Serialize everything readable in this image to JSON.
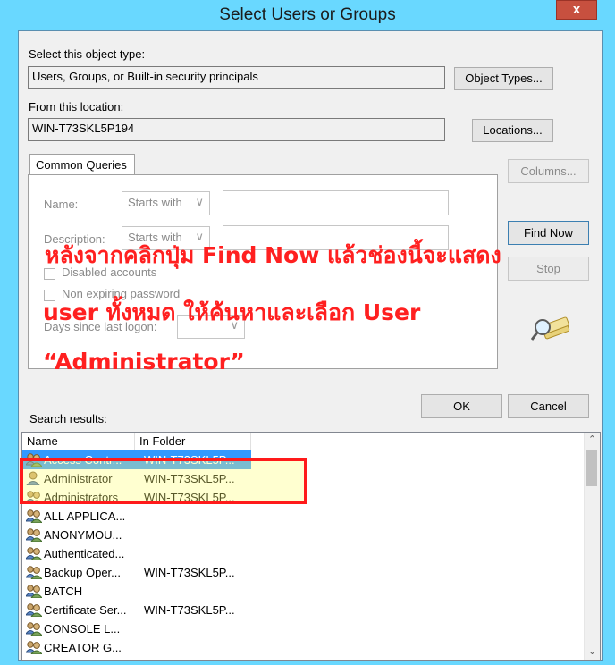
{
  "window": {
    "title": "Select Users or Groups",
    "close_glyph": "x"
  },
  "object_type": {
    "label": "Select this object type:",
    "value": "Users, Groups, or Built-in security principals",
    "button": "Object Types..."
  },
  "location": {
    "label": "From this location:",
    "value": "WIN-T73SKL5P194",
    "button": "Locations..."
  },
  "queries": {
    "tab": "Common Queries",
    "name_label": "Name:",
    "name_mode": "Starts with",
    "description_label": "Description:",
    "description_mode": "Starts with",
    "disabled_accounts": "Disabled accounts",
    "non_expiring_password": "Non expiring password",
    "days_since_last_logon": "Days since last logon:"
  },
  "buttons": {
    "columns": "Columns...",
    "find_now": "Find Now",
    "stop": "Stop",
    "ok": "OK",
    "cancel": "Cancel"
  },
  "annotation": {
    "line1": "หลังจากคลิกปุ่ม Find Now แล้วช่องนี้จะแสดง",
    "line2": "user ทั้งหมด ให้ค้นหาและเลือก User",
    "line3": "“Administrator”",
    "color": "#ff2020"
  },
  "results": {
    "label": "Search results:",
    "columns": [
      "Name",
      "In Folder"
    ],
    "rows": [
      {
        "name": "Access Contr...",
        "folder": "WIN-T73SKL5P...",
        "icon": "group-icon",
        "selected": true
      },
      {
        "name": "Administrator",
        "folder": "WIN-T73SKL5P...",
        "icon": "user-icon"
      },
      {
        "name": "Administrators",
        "folder": "WIN-T73SKL5P...",
        "icon": "group-icon"
      },
      {
        "name": "ALL APPLICA...",
        "folder": "",
        "icon": "group-icon"
      },
      {
        "name": "ANONYMOU...",
        "folder": "",
        "icon": "group-icon"
      },
      {
        "name": "Authenticated...",
        "folder": "",
        "icon": "group-icon"
      },
      {
        "name": "Backup Oper...",
        "folder": "WIN-T73SKL5P...",
        "icon": "group-icon"
      },
      {
        "name": "BATCH",
        "folder": "",
        "icon": "group-icon"
      },
      {
        "name": "Certificate Ser...",
        "folder": "WIN-T73SKL5P...",
        "icon": "group-icon"
      },
      {
        "name": "CONSOLE L...",
        "folder": "",
        "icon": "group-icon"
      },
      {
        "name": "CREATOR G...",
        "folder": "",
        "icon": "group-icon"
      }
    ]
  },
  "colors": {
    "frame": "#69d8ff",
    "selection": "#3399ff",
    "highlight_border": "#ff1a1a"
  }
}
